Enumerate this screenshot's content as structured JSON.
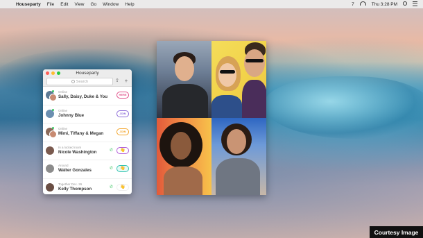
{
  "menubar": {
    "app_name": "Houseparty",
    "menus": [
      "File",
      "Edit",
      "View",
      "Go",
      "Window",
      "Help"
    ],
    "status_number": "7",
    "clock": "Thu 3:28 PM"
  },
  "houseparty": {
    "window_title": "Houseparty",
    "search_placeholder": "Search",
    "rows": [
      {
        "sub": "Online",
        "name": "Sally, Daisy, Duke & You",
        "action": "HERE"
      },
      {
        "sub": "Online",
        "name": "Johnny Blue",
        "action": "JOIN"
      },
      {
        "sub": "Online",
        "name": "Mimi, Tiffany & Megan",
        "action": "JOIN"
      },
      {
        "sub": "In a locked room",
        "name": "Nicole Washington",
        "action": "👋"
      },
      {
        "sub": "Around",
        "name": "Walter Gonzales",
        "action": "👋"
      },
      {
        "sub": "Together Dec. 26",
        "name": "Kelly Thompson",
        "action": "👋"
      }
    ]
  },
  "colors": {
    "here": "#e0508a",
    "join": "#8c6ad8",
    "join_alt": "#f4a52a",
    "online": "#3ac561"
  },
  "watermark": "Courtesy Image"
}
